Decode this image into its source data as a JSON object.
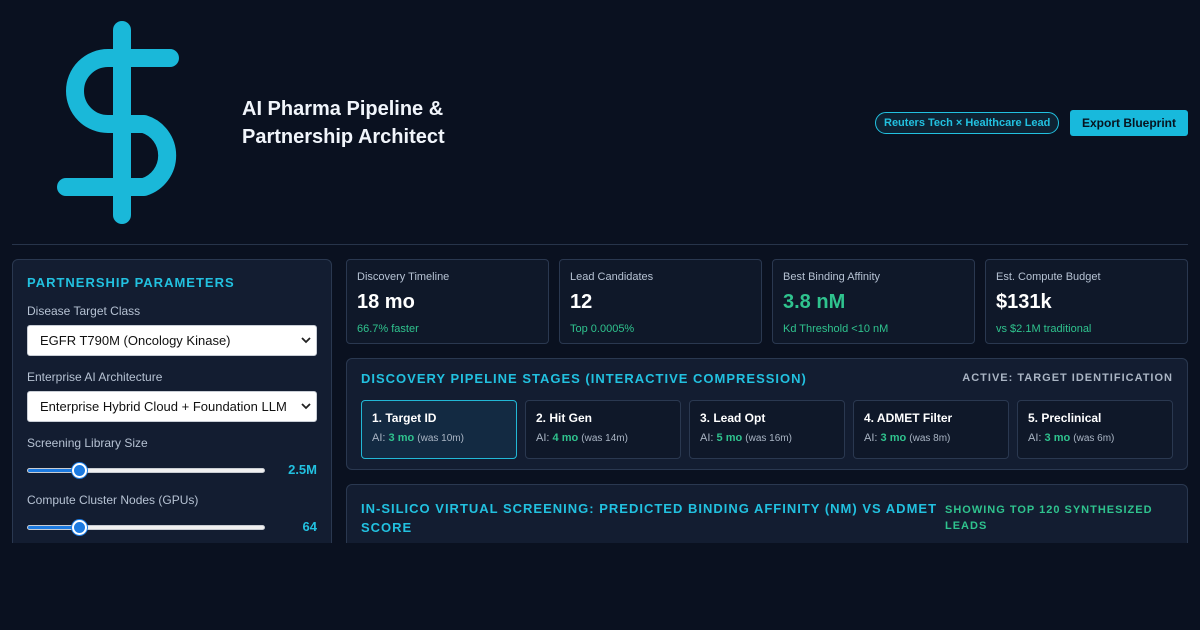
{
  "header": {
    "logo_icon": "dollar-sign-icon",
    "title": "AI Pharma Pipeline & Partnership Architect",
    "badge": "Reuters Tech × Healthcare Lead",
    "export_label": "Export Blueprint"
  },
  "colors": {
    "accent": "#22c1e0",
    "positive": "#2fc38e",
    "background": "#0a1120",
    "panel": "#131d31"
  },
  "params": {
    "title": "Partnership Parameters",
    "disease_label": "Disease Target Class",
    "disease_value": "EGFR T790M (Oncology Kinase)",
    "arch_label": "Enterprise AI Architecture",
    "arch_value": "Enterprise Hybrid Cloud + Foundation LLM",
    "library_label": "Screening Library Size",
    "library_value": "2.5M",
    "library_fraction": 0.22,
    "gpu_label": "Compute Cluster Nodes (GPUs)",
    "gpu_value": "64",
    "gpu_fraction": 0.22
  },
  "kpis": [
    {
      "label": "Discovery Timeline",
      "value": "18 mo",
      "sub": "66.7% faster"
    },
    {
      "label": "Lead Candidates",
      "value": "12",
      "sub": "Top 0.0005%"
    },
    {
      "label": "Best Binding Affinity",
      "value": "3.8 nM",
      "sub": "Kd Threshold <10 nM"
    },
    {
      "label": "Est. Compute Budget",
      "value": "$131k",
      "sub": "vs $2.1M traditional"
    }
  ],
  "pipeline": {
    "title": "Discovery Pipeline Stages (Interactive Compression)",
    "active_label": "Active: Target Identification",
    "stages": [
      {
        "name": "1. Target ID",
        "ai_prefix": "AI:",
        "ai": "3 mo",
        "was": "(was 10m)"
      },
      {
        "name": "2. Hit Gen",
        "ai_prefix": "AI:",
        "ai": "4 mo",
        "was": "(was 14m)"
      },
      {
        "name": "3. Lead Opt",
        "ai_prefix": "AI:",
        "ai": "5 mo",
        "was": "(was 16m)"
      },
      {
        "name": "4. ADMET Filter",
        "ai_prefix": "AI:",
        "ai": "3 mo",
        "was": "(was 8m)"
      },
      {
        "name": "5. Preclinical",
        "ai_prefix": "AI:",
        "ai": "3 mo",
        "was": "(was 6m)"
      }
    ]
  },
  "screening": {
    "title": "In-Silico Virtual Screening: Predicted Binding Affinity (nM) vs ADMET Score",
    "note": "Showing Top 120 Synthesized Leads"
  }
}
